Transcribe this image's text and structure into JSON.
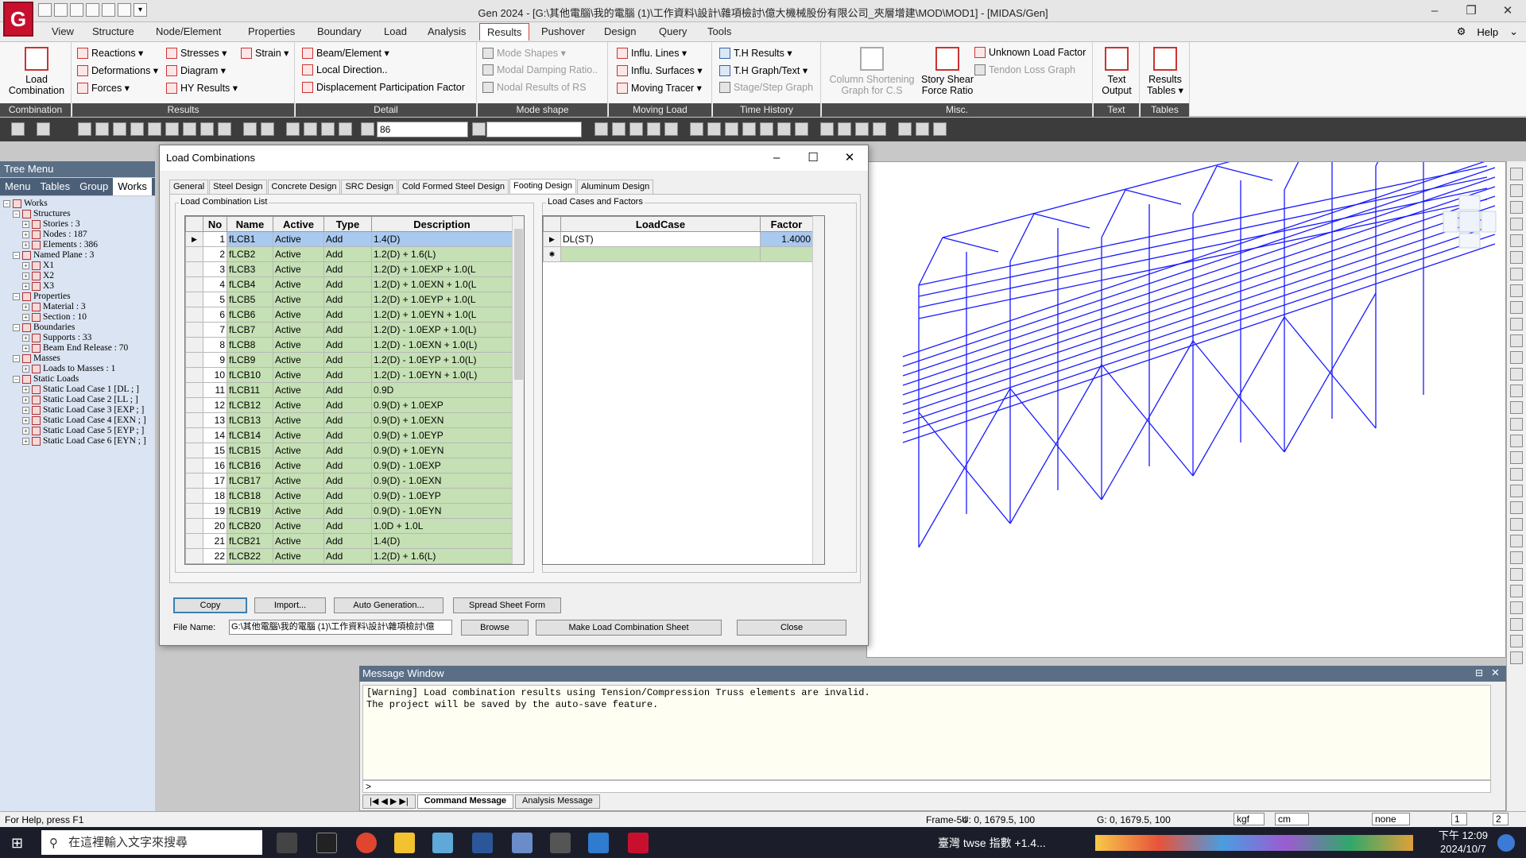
{
  "app": {
    "title": "Gen 2024 - [G:\\其他電腦\\我的電腦 (1)\\工作資料\\設計\\雜項檢討\\億大機械股份有限公司_夾層增建\\MOD\\MOD1] - [MIDAS/Gen]",
    "logo": "G",
    "help": "Help"
  },
  "menu": [
    "View",
    "Structure",
    "Node/Element",
    "Properties",
    "Boundary",
    "Load",
    "Analysis",
    "Results",
    "Pushover",
    "Design",
    "Query",
    "Tools"
  ],
  "menu_active": "Results",
  "ribbon": {
    "combination": {
      "big": "Load Combination",
      "label": "Combination"
    },
    "results": {
      "items": [
        "Reactions ▾",
        "Deformations ▾",
        "Forces ▾",
        "Stresses ▾",
        "Diagram ▾",
        "HY Results ▾",
        "Strain ▾"
      ],
      "label": "Results"
    },
    "detail": {
      "items": [
        "Beam/Element ▾",
        "Local Direction..",
        "Displacement Participation Factor"
      ],
      "label": "Detail"
    },
    "mode": {
      "items": [
        "Mode Shapes ▾",
        "Modal Damping Ratio..",
        "Nodal Results of RS"
      ],
      "label": "Mode shape"
    },
    "moving": {
      "items": [
        "Influ. Lines ▾",
        "Influ. Surfaces ▾",
        "Moving Tracer ▾"
      ],
      "label": "Moving Load"
    },
    "time": {
      "items": [
        "T.H Results ▾",
        "T.H Graph/Text ▾",
        "Stage/Step Graph"
      ],
      "label": "Time History"
    },
    "misc": {
      "items": [
        "Column Shortening Graph for C.S",
        "Story Shear Force Ratio",
        "Unknown Load Factor",
        "Tendon Loss Graph"
      ],
      "label": "Misc."
    },
    "text": {
      "big": "Text Output",
      "label": "Text"
    },
    "tables": {
      "big": "Results Tables ▾",
      "label": "Tables"
    }
  },
  "toolbar": {
    "field": "86"
  },
  "tree": {
    "title": "Tree Menu",
    "tabs": [
      "Menu",
      "Tables",
      "Group",
      "Works"
    ],
    "active_tab": "Works",
    "nodes": [
      {
        "t": "Works",
        "l": 0
      },
      {
        "t": "Structures",
        "l": 1
      },
      {
        "t": "Stories : 3",
        "l": 2
      },
      {
        "t": "Nodes : 187",
        "l": 2
      },
      {
        "t": "Elements : 386",
        "l": 2
      },
      {
        "t": "Named Plane : 3",
        "l": 1
      },
      {
        "t": "X1",
        "l": 2
      },
      {
        "t": "X2",
        "l": 2
      },
      {
        "t": "X3",
        "l": 2
      },
      {
        "t": "Properties",
        "l": 1
      },
      {
        "t": "Material : 3",
        "l": 2
      },
      {
        "t": "Section : 10",
        "l": 2
      },
      {
        "t": "Boundaries",
        "l": 1
      },
      {
        "t": "Supports : 33",
        "l": 2
      },
      {
        "t": "Beam End Release : 70",
        "l": 2
      },
      {
        "t": "Masses",
        "l": 1
      },
      {
        "t": "Loads to Masses : 1",
        "l": 2
      },
      {
        "t": "Static Loads",
        "l": 1
      },
      {
        "t": "Static Load Case 1 [DL ; ]",
        "l": 2
      },
      {
        "t": "Static Load Case 2 [LL ; ]",
        "l": 2
      },
      {
        "t": "Static Load Case 3 [EXP ; ]",
        "l": 2
      },
      {
        "t": "Static Load Case 4 [EXN ; ]",
        "l": 2
      },
      {
        "t": "Static Load Case 5 [EYP ; ]",
        "l": 2
      },
      {
        "t": "Static Load Case 6 [EYN ; ]",
        "l": 2
      }
    ]
  },
  "dialog": {
    "title": "Load Combinations",
    "tabs": [
      "General",
      "Steel Design",
      "Concrete Design",
      "SRC Design",
      "Cold Formed Steel Design",
      "Footing Design",
      "Aluminum Design"
    ],
    "active_tab": "Footing Design",
    "list_label": "Load Combination List",
    "cases_label": "Load Cases and Factors",
    "columns": [
      "No",
      "Name",
      "Active",
      "Type",
      "Description"
    ],
    "rows": [
      [
        1,
        "fLCB1",
        "Active",
        "Add",
        "1.4(D)"
      ],
      [
        2,
        "fLCB2",
        "Active",
        "Add",
        "1.2(D) + 1.6(L)"
      ],
      [
        3,
        "fLCB3",
        "Active",
        "Add",
        "1.2(D) + 1.0EXP + 1.0(L"
      ],
      [
        4,
        "fLCB4",
        "Active",
        "Add",
        "1.2(D) + 1.0EXN + 1.0(L"
      ],
      [
        5,
        "fLCB5",
        "Active",
        "Add",
        "1.2(D) + 1.0EYP + 1.0(L"
      ],
      [
        6,
        "fLCB6",
        "Active",
        "Add",
        "1.2(D) + 1.0EYN + 1.0(L"
      ],
      [
        7,
        "fLCB7",
        "Active",
        "Add",
        "1.2(D) - 1.0EXP + 1.0(L)"
      ],
      [
        8,
        "fLCB8",
        "Active",
        "Add",
        "1.2(D) - 1.0EXN + 1.0(L)"
      ],
      [
        9,
        "fLCB9",
        "Active",
        "Add",
        "1.2(D) - 1.0EYP + 1.0(L)"
      ],
      [
        10,
        "fLCB10",
        "Active",
        "Add",
        "1.2(D) - 1.0EYN + 1.0(L)"
      ],
      [
        11,
        "fLCB11",
        "Active",
        "Add",
        "0.9D"
      ],
      [
        12,
        "fLCB12",
        "Active",
        "Add",
        "0.9(D) + 1.0EXP"
      ],
      [
        13,
        "fLCB13",
        "Active",
        "Add",
        "0.9(D) + 1.0EXN"
      ],
      [
        14,
        "fLCB14",
        "Active",
        "Add",
        "0.9(D) + 1.0EYP"
      ],
      [
        15,
        "fLCB15",
        "Active",
        "Add",
        "0.9(D) + 1.0EYN"
      ],
      [
        16,
        "fLCB16",
        "Active",
        "Add",
        "0.9(D) - 1.0EXP"
      ],
      [
        17,
        "fLCB17",
        "Active",
        "Add",
        "0.9(D) - 1.0EXN"
      ],
      [
        18,
        "fLCB18",
        "Active",
        "Add",
        "0.9(D) - 1.0EYP"
      ],
      [
        19,
        "fLCB19",
        "Active",
        "Add",
        "0.9(D) - 1.0EYN"
      ],
      [
        20,
        "fLCB20",
        "Active",
        "Add",
        "1.0D + 1.0L"
      ],
      [
        21,
        "fLCB21",
        "Active",
        "Add",
        "1.4(D)"
      ],
      [
        22,
        "fLCB22",
        "Active",
        "Add",
        "1.2(D) + 1.6(L)"
      ]
    ],
    "case_columns": [
      "LoadCase",
      "Factor"
    ],
    "cases": [
      [
        "DL(ST)",
        "1.4000"
      ]
    ],
    "buttons": {
      "copy": "Copy",
      "import": "Import...",
      "auto": "Auto Generation...",
      "spread": "Spread Sheet Form",
      "browse": "Browse",
      "make": "Make Load Combination Sheet",
      "close": "Close"
    },
    "file_label": "File Name:",
    "file_value": "G:\\其他電腦\\我的電腦 (1)\\工作資料\\設計\\雜項檢討\\億"
  },
  "message": {
    "title": "Message Window",
    "lines": [
      "[Warning] Load combination results using Tension/Compression Truss elements are invalid.",
      "The project will be saved by the auto-save feature."
    ],
    "prompt": ">",
    "tabs": [
      "Command Message",
      "Analysis Message"
    ]
  },
  "status": {
    "help": "For Help, press F1",
    "frame": "Frame-54",
    "u": "U: 0, 1679.5, 100",
    "g": "G: 0, 1679.5, 100",
    "force": "kgf",
    "length": "cm",
    "mode": "none",
    "page": "1",
    "total": "2"
  },
  "taskbar": {
    "search": "在這裡輸入文字來搜尋",
    "ticker": "臺灣 twse 指數  +1.4...",
    "time": "下午 12:09",
    "date": "2024/10/7"
  },
  "colors": {
    "accent": "#c8102e",
    "model_line": "#1a1aff",
    "row_green": "#c5e0b4"
  }
}
